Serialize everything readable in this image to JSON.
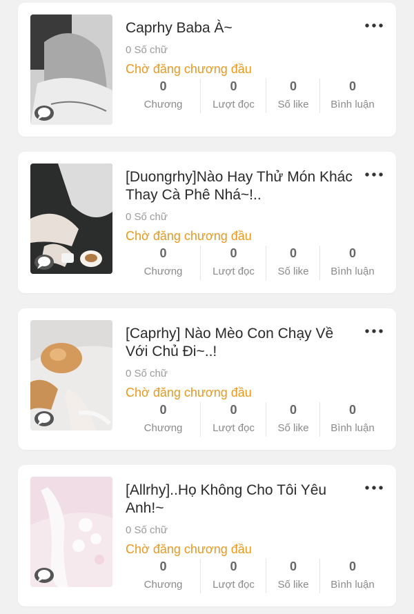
{
  "stat_labels": [
    "Chương",
    "Lượt đọc",
    "Số like",
    "Bình luận"
  ],
  "stories": [
    {
      "title": "Caprhy Baba À~",
      "word_count": "0 Số chữ",
      "status": "Chờ đăng chương đầu",
      "stats": {
        "chapters": "0",
        "reads": "0",
        "likes": "0",
        "comments": "0"
      }
    },
    {
      "title": "[Duongrhy]Nào Hay Thử Món Khác Thay Cà Phê Nhá~!..",
      "word_count": "0 Số chữ",
      "status": "Chờ đăng chương đầu",
      "stats": {
        "chapters": "0",
        "reads": "0",
        "likes": "0",
        "comments": "0"
      }
    },
    {
      "title": "[Caprhy] Nào Mèo Con Chạy Về Với Chủ Đi~..!",
      "word_count": "0 Số chữ",
      "status": "Chờ đăng chương đầu",
      "stats": {
        "chapters": "0",
        "reads": "0",
        "likes": "0",
        "comments": "0"
      }
    },
    {
      "title": "[Allrhy]..Họ Không Cho Tôi Yêu Anh!~",
      "word_count": "0 Số chữ",
      "status": "Chờ đăng chương đầu",
      "stats": {
        "chapters": "0",
        "reads": "0",
        "likes": "0",
        "comments": "0"
      }
    }
  ],
  "colors": {
    "status": "#e8991d",
    "background": "#f1f1f1",
    "card": "#ffffff"
  },
  "icons": [
    "more-dots-icon",
    "chat-bubble-icon"
  ]
}
